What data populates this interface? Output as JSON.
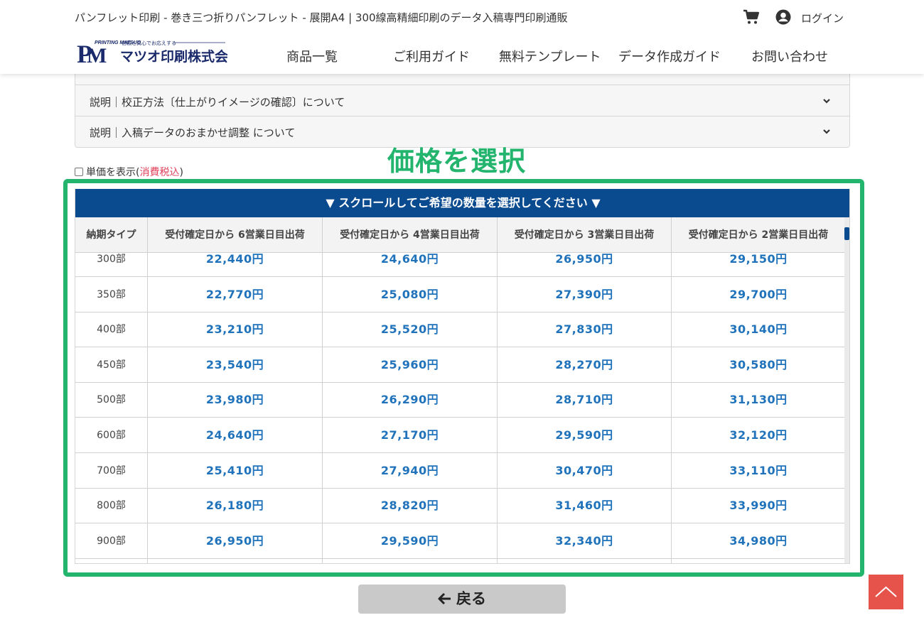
{
  "header": {
    "site_title": "パンフレット印刷 - 巻き三つ折りパンフレット - 展開A4 | 300線高精細印刷のデータ入稿専門印刷通販",
    "login_label": "ログイン",
    "logo_text": "マツオ印刷株式会社",
    "logo_tagline": "信頼と真心でお応えする",
    "logo_brand": "PRINTING MATSUO",
    "nav": [
      "商品一覧",
      "ご利用ガイド",
      "無料テンプレート",
      "データ作成ガイド",
      "お問い合わせ"
    ]
  },
  "accordion": {
    "items": [
      "説明｜校正方法〔仕上がりイメージの確認〕について",
      "説明｜入稿データのおまかせ調整 について"
    ]
  },
  "annotation": {
    "title": "価格を選択"
  },
  "unit_price": {
    "label": "単価を表示(",
    "tax_label": "消費税込",
    "close": ")"
  },
  "price_table": {
    "banner": "▼ スクロールしてご希望の数量を選択してください ▼",
    "headers": [
      "納期タイプ",
      "受付確定日から 6営業日目出荷",
      "受付確定日から 4営業日目出荷",
      "受付確定日から 3営業日目出荷",
      "受付確定日から 2営業日目出荷"
    ],
    "rows": [
      {
        "qty": "300部",
        "prices": [
          "22,440円",
          "24,640円",
          "26,950円",
          "29,150円"
        ]
      },
      {
        "qty": "350部",
        "prices": [
          "22,770円",
          "25,080円",
          "27,390円",
          "29,700円"
        ]
      },
      {
        "qty": "400部",
        "prices": [
          "23,210円",
          "25,520円",
          "27,830円",
          "30,140円"
        ]
      },
      {
        "qty": "450部",
        "prices": [
          "23,540円",
          "25,960円",
          "28,270円",
          "30,580円"
        ]
      },
      {
        "qty": "500部",
        "prices": [
          "23,980円",
          "26,290円",
          "28,710円",
          "31,130円"
        ]
      },
      {
        "qty": "600部",
        "prices": [
          "24,640円",
          "27,170円",
          "29,590円",
          "32,120円"
        ]
      },
      {
        "qty": "700部",
        "prices": [
          "25,410円",
          "27,940円",
          "30,470円",
          "33,110円"
        ]
      },
      {
        "qty": "800部",
        "prices": [
          "26,180円",
          "28,820円",
          "31,460円",
          "33,990円"
        ]
      },
      {
        "qty": "900部",
        "prices": [
          "26,950円",
          "29,590円",
          "32,340円",
          "34,980円"
        ]
      }
    ]
  },
  "back_button": {
    "label": "戻る"
  },
  "colors": {
    "accent_green": "#23b46d",
    "banner_blue": "#0a4a8f",
    "price_blue": "#2073bb",
    "pagetop_red": "#e5534b"
  },
  "icons": [
    "cart-icon",
    "user-circle-icon",
    "chevron-down-icon",
    "arrow-left-icon",
    "chevron-up-icon"
  ]
}
